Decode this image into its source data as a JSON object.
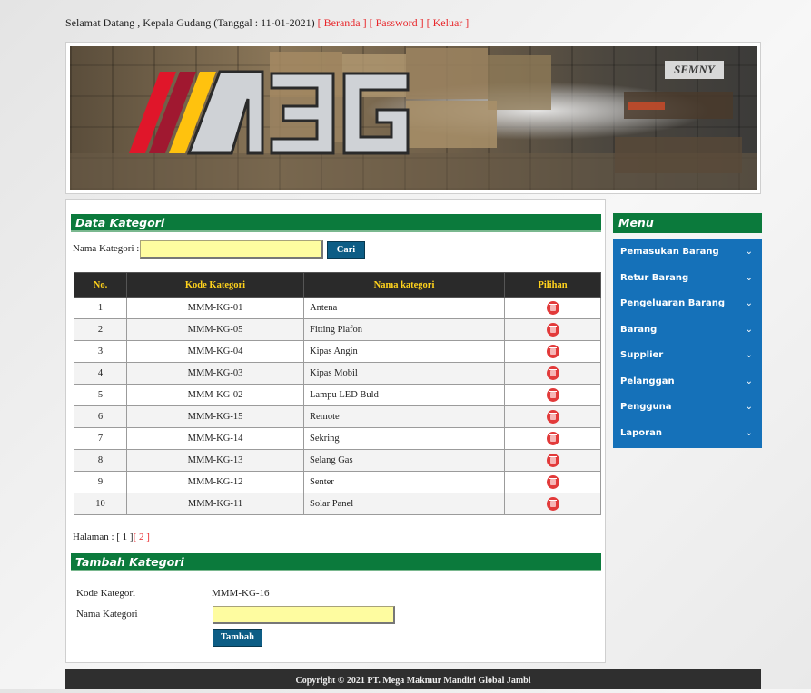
{
  "header": {
    "greeting": "Selamat Datang , Kepala Gudang (Tanggal : 11-01-2021)",
    "links": [
      "[ Beranda ]",
      "[ Password ]",
      "[ Keluar ]"
    ],
    "banner_text": "SEMNY"
  },
  "main": {
    "title": "Data Kategori",
    "search": {
      "label": "Nama Kategori :",
      "value": "",
      "button": "Cari"
    },
    "table": {
      "columns": [
        "No.",
        "Kode Kategori",
        "Nama kategori",
        "Pilihan"
      ],
      "rows": [
        [
          "1",
          "MMM-KG-01",
          "Antena"
        ],
        [
          "2",
          "MMM-KG-05",
          "Fitting Plafon"
        ],
        [
          "3",
          "MMM-KG-04",
          "Kipas Angin"
        ],
        [
          "4",
          "MMM-KG-03",
          "Kipas Mobil"
        ],
        [
          "5",
          "MMM-KG-02",
          "Lampu LED Buld"
        ],
        [
          "6",
          "MMM-KG-15",
          "Remote"
        ],
        [
          "7",
          "MMM-KG-14",
          "Sekring"
        ],
        [
          "8",
          "MMM-KG-13",
          "Selang Gas"
        ],
        [
          "9",
          "MMM-KG-12",
          "Senter"
        ],
        [
          "10",
          "MMM-KG-11",
          "Solar Panel"
        ]
      ]
    },
    "pagination": {
      "label": "Halaman :",
      "pages": [
        "[ 1 ]",
        "[ 2 ]"
      ]
    },
    "add": {
      "title": "Tambah Kategori",
      "kode_label": "Kode Kategori",
      "kode_value": "MMM-KG-16",
      "nama_label": "Nama Kategori",
      "nama_value": "",
      "button": "Tambah"
    }
  },
  "sidebar": {
    "title": "Menu",
    "items": [
      {
        "label": "Pemasukan Barang"
      },
      {
        "label": "Retur Barang"
      },
      {
        "label": "Pengeluaran Barang"
      },
      {
        "label": "Barang"
      },
      {
        "label": "Supplier"
      },
      {
        "label": "Pelanggan"
      },
      {
        "label": "Pengguna"
      },
      {
        "label": "Laporan"
      }
    ]
  },
  "footer": {
    "copyright": "Copyright © 2021 PT. Mega Makmur Mandiri Global Jambi"
  },
  "colors": {
    "section_green": "#0b7a3c",
    "menu_blue": "#1571b9",
    "link_red": "#e8262a",
    "header_yellow": "#ffd21c",
    "input_yellow": "#fefca0",
    "button_blue": "#0d5d85",
    "delete_red": "#e23a3a",
    "footer_dark": "#2f2f2f"
  }
}
